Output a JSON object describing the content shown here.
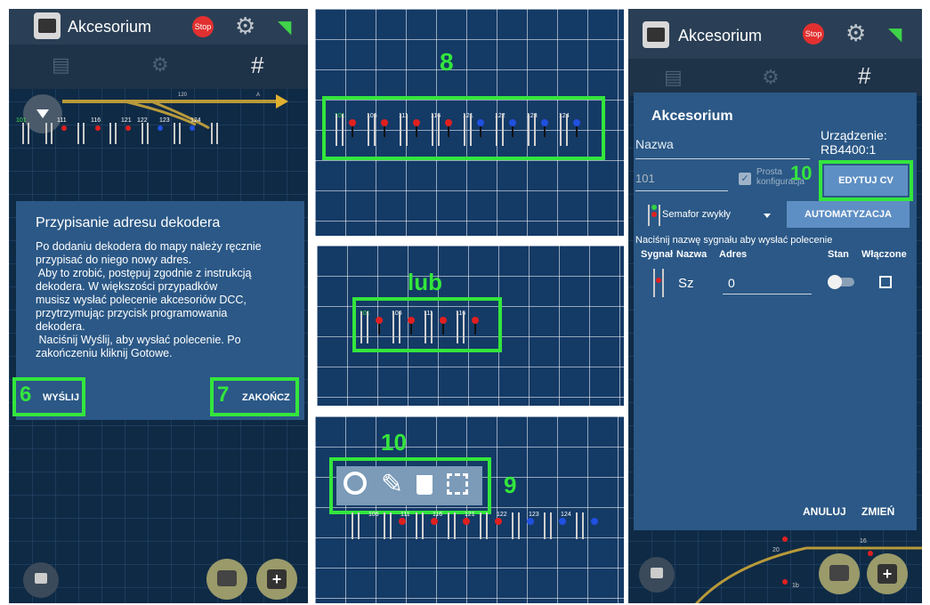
{
  "app": {
    "title": "Akcesorium",
    "stop_label": "Stop"
  },
  "panel1": {
    "dialog_title": "Przypisanie adresu dekodera",
    "dialog_text": [
      "Po dodaniu dekodera do mapy należy ręcznie",
      "przypisać do niego nowy adres.",
      " Aby to zrobić, postępuj zgodnie z instrukcją",
      "dekodera. W większości przypadków",
      "musisz wysłać polecenie akcesoriów DCC,",
      "przytrzymując przycisk programowania",
      "dekodera.",
      " Naciśnij Wyślij, aby wysłać polecenie. Po",
      "zakończeniu kliknij Gotowe."
    ],
    "send_label": "WYŚLIJ",
    "finish_label": "ZAKOŃCZ",
    "send_step": "6",
    "finish_step": "7",
    "signal_numbers": [
      "101",
      "111",
      "116",
      "121",
      "122",
      "123",
      "124"
    ],
    "track_marks": [
      "120",
      "A"
    ]
  },
  "panel2": {
    "step": "8",
    "signal_numbers": [
      "101",
      "106",
      "111",
      "116",
      "121",
      "122",
      "123",
      "124"
    ]
  },
  "panel3": {
    "step": "lub",
    "signal_numbers": [
      "101",
      "106",
      "111",
      "116"
    ]
  },
  "panel4": {
    "step_top": "10",
    "step_right": "9",
    "signal_numbers": [
      "106",
      "111",
      "116",
      "121",
      "122",
      "123",
      "124"
    ]
  },
  "panel5": {
    "dialog_title": "Akcesorium",
    "name_label": "Nazwa",
    "device_label": "Urządzenie:",
    "device_value": "RB4400:1",
    "address_value": "101",
    "simple_config": "Prosta konfiguracja",
    "edit_cv": "EDYTUJ CV",
    "edit_step": "10",
    "signal_type": "Semafor zwykły",
    "automation": "AUTOMATYZACJA",
    "hint": "Naciśnij nazwę sygnału aby wysłać polecenie",
    "columns": [
      "Sygnał",
      "Nazwa",
      "Adres",
      "Stan",
      "Włączone"
    ],
    "row_name": "Sz",
    "row_address": "0",
    "cancel": "ANULUJ",
    "change": "ZMIEŃ",
    "bg_numbers": [
      "20",
      "16",
      "1b"
    ]
  },
  "colors": {
    "highlight": "#33e63c",
    "dialog": "#2b5886",
    "button": "#5e8fc4"
  }
}
